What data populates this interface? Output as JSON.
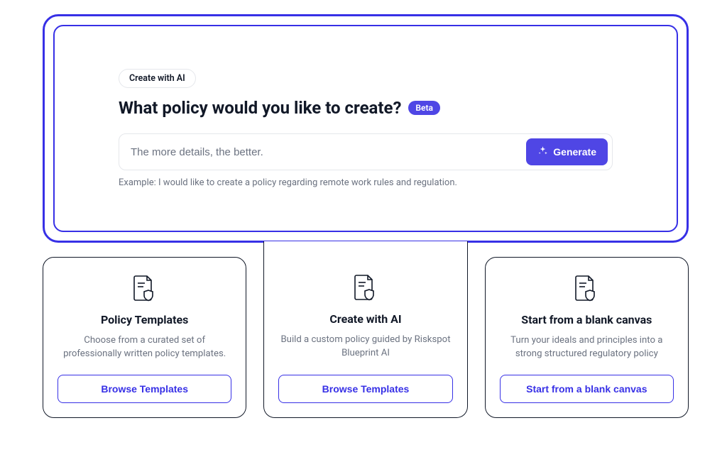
{
  "hero": {
    "tag": "Create with AI",
    "title": "What policy would you like to create?",
    "badge": "Beta",
    "placeholder": "The more details, the better.",
    "generate_label": "Generate",
    "example": "Example: I would like to create a policy regarding remote work rules and regulation."
  },
  "options": [
    {
      "title": "Policy Templates",
      "desc": "Choose from a curated set of professionally written policy templates.",
      "button": "Browse Templates"
    },
    {
      "title": "Create with AI",
      "desc": "Build a custom policy guided by Riskspot Blueprint AI",
      "button": "Browse Templates"
    },
    {
      "title": "Start from a blank canvas",
      "desc": "Turn your ideals and principles into a strong structured regulatory policy",
      "button": "Start from a blank canvas"
    }
  ],
  "colors": {
    "accent": "#3730E6",
    "accent_fill": "#4F46E5"
  }
}
